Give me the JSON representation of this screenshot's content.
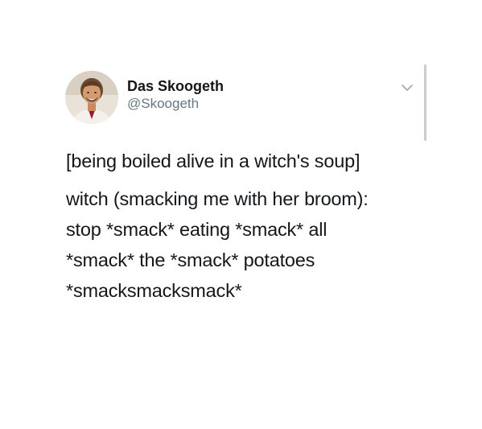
{
  "author": {
    "display_name": "Das Skoogeth",
    "handle": "@Skoogeth"
  },
  "icons": {
    "menu": "chevron-down-icon",
    "avatar": "profile-photo"
  },
  "tweet": {
    "lines": [
      "[being boiled alive in a witch's soup]",
      "witch (smacking me with her broom):",
      "stop *smack* eating *smack* all",
      "*smack* the *smack* potatoes",
      "*smacksmacksmack*"
    ]
  },
  "colors": {
    "text": "#14171a",
    "secondary": "#657786",
    "background": "#ffffff"
  }
}
